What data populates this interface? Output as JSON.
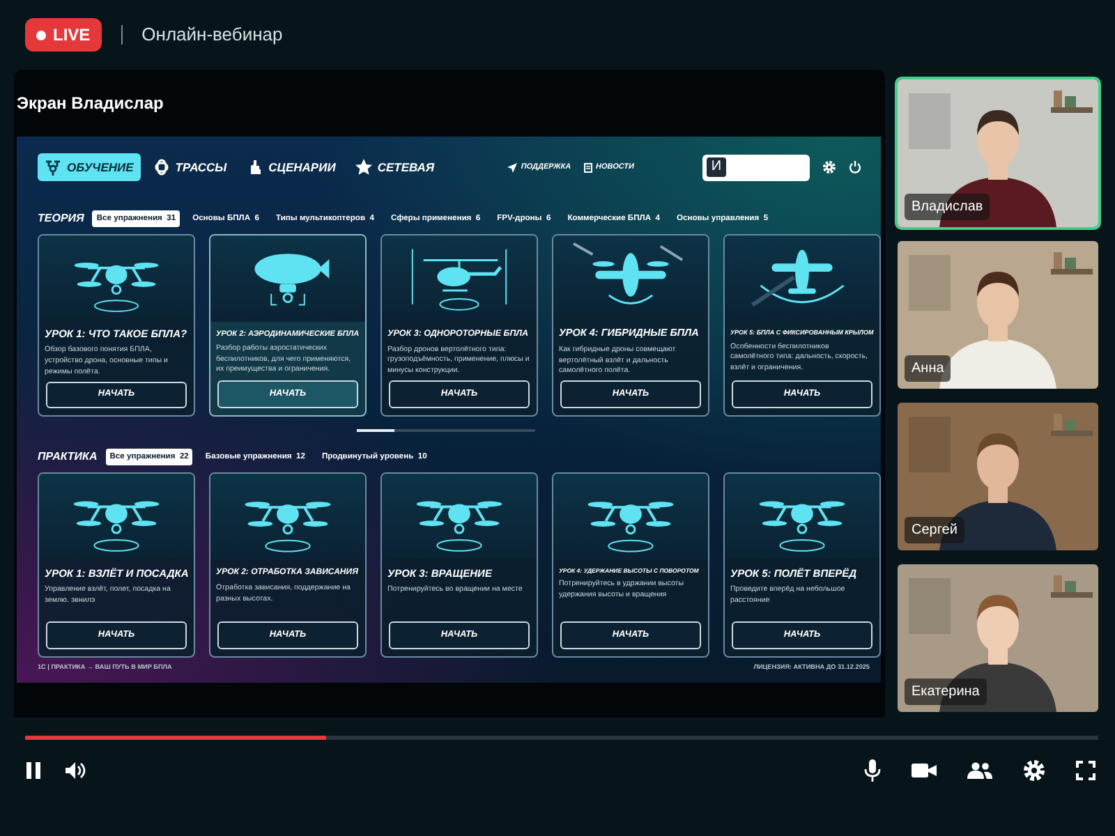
{
  "header": {
    "live_badge": "LIVE",
    "title": "Онлайн-вебинар"
  },
  "screen_share": {
    "title": "Экран Владислар",
    "app": {
      "nav_tabs": [
        {
          "label": "ОБУЧЕНИЕ",
          "kind": "training",
          "selected": true
        },
        {
          "label": "ТРАССЫ",
          "kind": "routes",
          "selected": false
        },
        {
          "label": "СЦЕНАРИИ",
          "kind": "scenarios",
          "selected": false
        },
        {
          "label": "СЕТЕВАЯ",
          "kind": "network",
          "selected": false
        }
      ],
      "links": [
        {
          "label": "ПОДДЕРЖКА",
          "kind": "support"
        },
        {
          "label": "НОВОСТИ",
          "kind": "news"
        }
      ],
      "user_field": {
        "avatar_letter": "И"
      },
      "sections": [
        {
          "title": "ТЕОРИЯ",
          "filters": [
            {
              "label": "Все упражнения",
              "count": "31",
              "selected": true
            },
            {
              "label": "Основы БПЛА",
              "count": "6",
              "selected": false
            },
            {
              "label": "Типы мультикоптеров",
              "count": "4",
              "selected": false
            },
            {
              "label": "Сферы применения",
              "count": "6",
              "selected": false
            },
            {
              "label": "FPV-дроны",
              "count": "6",
              "selected": false
            },
            {
              "label": "Коммерческие БПЛА",
              "count": "4",
              "selected": false
            },
            {
              "label": "Основы управления",
              "count": "5",
              "selected": false
            }
          ],
          "cards": [
            {
              "kind": "quadcopter",
              "title": "УРОК 1: ЧТО ТАКОЕ БПЛА?",
              "description": "Обзор базового понятия БПЛА, устройство дрона, основные типы и режимы полёта.",
              "button": "НАЧАТЬ",
              "selected": false
            },
            {
              "kind": "airship",
              "title": "УРОК 2: АЭРОДИНАМИЧЕСКИЕ БПЛА",
              "description": "Разбор работы аэростатических беспилотников, для чего применяются, их преимущества и ограничения.",
              "button": "НАЧАТЬ",
              "selected": true
            },
            {
              "kind": "helicopter",
              "title": "УРОК 3: ОДНОРОТОРНЫЕ БПЛА",
              "description": "Разбор дронов вертолётного типа: грузоподъёмность, применение, плюсы и минусы конструкции.",
              "button": "НАЧАТЬ",
              "selected": false
            },
            {
              "kind": "hybrid",
              "title": "УРОК 4: ГИБРИДНЫЕ БПЛА",
              "description": "Как гибридные дроны совмещают вертолётный взлёт и дальность самолётного полёта.",
              "button": "НАЧАТЬ",
              "selected": false
            },
            {
              "kind": "airplane",
              "title": "УРОК 5: БПЛА С ФИКСИРОВАННЫМ КРЫЛОМ",
              "description": "Особенности беспилотников самолётного типа: дальность, скорость, взлёт и ограничения.",
              "button": "НАЧАТЬ",
              "selected": false
            }
          ]
        },
        {
          "title": "ПРАКТИКА",
          "filters": [
            {
              "label": "Все упражнения",
              "count": "22",
              "selected": true
            },
            {
              "label": "Базовые упражнения",
              "count": "12",
              "selected": false
            },
            {
              "label": "Продвинутый уровень",
              "count": "10",
              "selected": false
            }
          ],
          "cards": [
            {
              "kind": "quadcopter",
              "title": "УРОК 1: ВЗЛЁТ И ПОСАДКА",
              "description": "Управление взлёт, полет, посадка на землю. эвнилэ",
              "button": "НАЧАТЬ",
              "selected": false
            },
            {
              "kind": "quadcopter",
              "title": "УРОК 2: ОТРАБОТКА ЗАВИСАНИЯ",
              "description": "Отработка зависания, поддержание на разных высотах.",
              "button": "НАЧАТЬ",
              "selected": false
            },
            {
              "kind": "quadcopter",
              "title": "УРОК 3: ВРАЩЕНИЕ",
              "description": "Потренируйтесь во вращении на месте",
              "button": "НАЧАТЬ",
              "selected": false
            },
            {
              "kind": "quadcopter",
              "title": "УРОК 4: УДЕРЖАНИЕ ВЫСОТЫ С ПОВОРОТОМ",
              "description": "Потренируйтесь в удржании высоты удержания высоты и вращения",
              "button": "НАЧАТЬ",
              "selected": false
            },
            {
              "kind": "quadcopter",
              "title": "УРОК 5: ПОЛЁТ ВПЕРЁД",
              "description": "Проведите вперёд на небольшое расстояние",
              "button": "НАЧАТЬ",
              "selected": false
            }
          ]
        }
      ],
      "footer": {
        "left": "1С | ПРАКТИКА → ВАШ ПУТЬ В МИР БПЛА",
        "right": "ЛИЦЕНЗИЯ: АКТИВНА ДО 31.12.2025"
      }
    }
  },
  "participants": [
    {
      "name": "Владислав",
      "speaking": true
    },
    {
      "name": "Анна",
      "speaking": false
    },
    {
      "name": "Сергей",
      "speaking": false
    },
    {
      "name": "Екатерина",
      "speaking": false
    }
  ],
  "player": {
    "progress": {
      "level": 0.28
    }
  }
}
